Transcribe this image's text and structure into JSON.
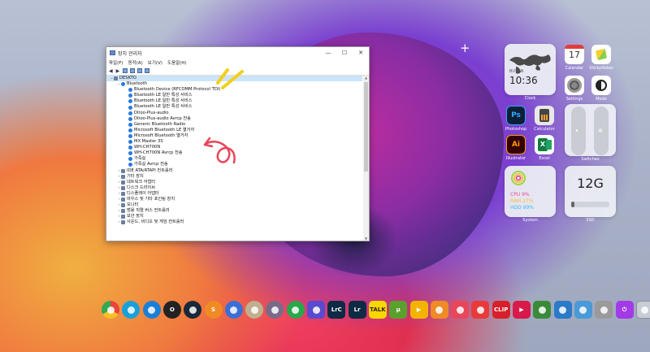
{
  "window": {
    "title": "장치 관리자",
    "controls": [
      "—",
      "☐",
      "✕"
    ],
    "menu": [
      "파일(F)",
      "동작(A)",
      "보기(V)",
      "도움말(H)"
    ],
    "tree": [
      {
        "label": "DESKTO",
        "level": 0,
        "expanded": true,
        "selected": true
      },
      {
        "label": "Bluetooth",
        "level": 1,
        "expanded": true
      },
      {
        "label": "Bluetooth Device (RFCOMM Protocol TDI)",
        "level": 2
      },
      {
        "label": "Bluetooth LE 일반 특성 서비스",
        "level": 2
      },
      {
        "label": "Bluetooth LE 일반 특성 서비스",
        "level": 2
      },
      {
        "label": "Bluetooth LE 일반 특성 서비스",
        "level": 2
      },
      {
        "label": "Ditoo-Plus-audio",
        "level": 2
      },
      {
        "label": "Ditoo-Plus-audio Avrcp 전송",
        "level": 2
      },
      {
        "label": "Generic Bluetooth Radio",
        "level": 2
      },
      {
        "label": "Microsoft Bluetooth LE 열거자",
        "level": 2
      },
      {
        "label": "Microsoft Bluetooth 열거자",
        "level": 2
      },
      {
        "label": "MX Master 3S",
        "level": 2
      },
      {
        "label": "WH-CH700N",
        "level": 2
      },
      {
        "label": "WH-CH700N Avrcp 전송",
        "level": 2
      },
      {
        "label": "가족실",
        "level": 2
      },
      {
        "label": "가족실 Avrcp 전송",
        "level": 2
      },
      {
        "label": "IDE ATA/ATAPI 컨트롤러",
        "level": 1
      },
      {
        "label": "기타 장치",
        "level": 1
      },
      {
        "label": "네트워크 어댑터",
        "level": 1
      },
      {
        "label": "디스크 드라이브",
        "level": 1
      },
      {
        "label": "디스플레이 어댑터",
        "level": 1
      },
      {
        "label": "마우스 및 기타 포인팅 장치",
        "level": 1
      },
      {
        "label": "모니터",
        "level": 1
      },
      {
        "label": "범용 직렬 버스 컨트롤러",
        "level": 1
      },
      {
        "label": "보안 장치",
        "level": 1
      },
      {
        "label": "사운드, 비디오 및 게임 컨트롤러",
        "level": 1
      }
    ]
  },
  "widgets": {
    "clock": {
      "city": "BUSAN",
      "time": "10:36",
      "label": "Clock"
    },
    "calendar": {
      "day": "17",
      "label": "Calendar"
    },
    "stickynotes": {
      "label": "StickyNotes"
    },
    "settings": {
      "label": "Settings"
    },
    "mode": {
      "label": "Mode"
    },
    "photoshop": {
      "label": "Photoshop",
      "glyph": "Ps"
    },
    "calculator": {
      "label": "Calculator"
    },
    "illustrator": {
      "label": "Illustrator",
      "glyph": "Ai"
    },
    "excel": {
      "label": "Excel",
      "glyph": "X"
    },
    "switches": {
      "label": "Switches"
    },
    "system": {
      "cpu": "CPU 9%",
      "ram": "RAM 27%",
      "hdd": "HDD 99%",
      "label": "System"
    },
    "ssd": {
      "value": "12G",
      "label": "SSD"
    }
  },
  "dock": [
    {
      "name": "chrome-icon",
      "glyph": "",
      "color": "#e8453c"
    },
    {
      "name": "edge-dev-icon",
      "glyph": "",
      "color": "#1aa0d8"
    },
    {
      "name": "edge-icon",
      "glyph": "",
      "color": "#1b7fd6"
    },
    {
      "name": "opera-icon",
      "glyph": "O",
      "color": "#222222"
    },
    {
      "name": "steam-icon",
      "glyph": "",
      "color": "#1b2838"
    },
    {
      "name": "sticker-icon",
      "glyph": "S",
      "color": "#f08a24"
    },
    {
      "name": "bluetooth-app-icon",
      "glyph": "",
      "color": "#3a6fd8"
    },
    {
      "name": "installer-icon",
      "glyph": "",
      "color": "#c0b090"
    },
    {
      "name": "game-icon",
      "glyph": "",
      "color": "#7a6a8a"
    },
    {
      "name": "tree-icon",
      "glyph": "",
      "color": "#27a84a"
    },
    {
      "name": "chip-icon",
      "glyph": "",
      "color": "#5a4ad0"
    },
    {
      "name": "lightroom-classic-icon",
      "glyph": "LrC",
      "color": "#0f2a44"
    },
    {
      "name": "lightroom-icon",
      "glyph": "Lr",
      "color": "#0f2a44"
    },
    {
      "name": "kakaotalk-icon",
      "glyph": "TALK",
      "color": "#f7d800"
    },
    {
      "name": "utorrent-icon",
      "glyph": "µ",
      "color": "#5aa02c"
    },
    {
      "name": "player-icon",
      "glyph": "▶",
      "color": "#f2b400"
    },
    {
      "name": "camera-icon",
      "glyph": "",
      "color": "#f08a24"
    },
    {
      "name": "screenshot-icon",
      "glyph": "",
      "color": "#e8465a"
    },
    {
      "name": "crop-icon",
      "glyph": "",
      "color": "#e83a3a"
    },
    {
      "name": "clip-icon",
      "glyph": "CLIP",
      "color": "#d8202a"
    },
    {
      "name": "media-player-icon",
      "glyph": "▶",
      "color": "#d81a4a"
    },
    {
      "name": "checklist-icon",
      "glyph": "",
      "color": "#3a8a3a"
    },
    {
      "name": "monitor-icon",
      "glyph": "",
      "color": "#2a7ac8"
    },
    {
      "name": "control-panel-icon",
      "glyph": "",
      "color": "#4a9ad8"
    },
    {
      "name": "tools-icon",
      "glyph": "",
      "color": "#9a9a9a"
    },
    {
      "name": "power-icon",
      "glyph": "⏻",
      "color": "#a23ae8"
    },
    {
      "name": "recycle-bin-icon",
      "glyph": "",
      "color": "#c8ccd4"
    }
  ]
}
